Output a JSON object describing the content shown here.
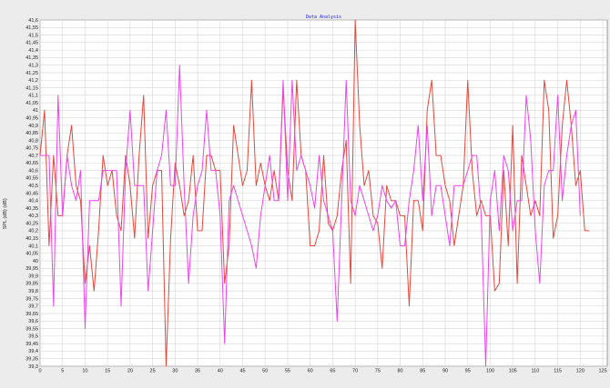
{
  "chart_data": {
    "type": "line",
    "title": "Data Analysis",
    "ylabel": "SPL (dB) (dB)",
    "xlabel": "",
    "grid": true,
    "legend": "none",
    "xlim": [
      0,
      126
    ],
    "ylim": [
      39.3,
      41.6
    ],
    "y_ticks": [
      "39,3",
      "39,35",
      "39,4",
      "39,45",
      "39,5",
      "39,55",
      "39,6",
      "39,65",
      "39,7",
      "39,75",
      "39,8",
      "39,85",
      "39,9",
      "39,95",
      "40",
      "40,05",
      "40,1",
      "40,15",
      "40,2",
      "40,25",
      "40,3",
      "40,35",
      "40,4",
      "40,45",
      "40,5",
      "40,55",
      "40,6",
      "40,65",
      "40,7",
      "40,75",
      "40,8",
      "40,85",
      "40,9",
      "40,95",
      "41",
      "41,05",
      "41,1",
      "41,15",
      "41,2",
      "41,25",
      "41,3",
      "41,35",
      "41,4",
      "41,45",
      "41,5",
      "41,55",
      "41,6"
    ],
    "y_tick_values": [
      39.3,
      39.35,
      39.4,
      39.45,
      39.5,
      39.55,
      39.6,
      39.65,
      39.7,
      39.75,
      39.8,
      39.85,
      39.9,
      39.95,
      40,
      40.05,
      40.1,
      40.15,
      40.2,
      40.25,
      40.3,
      40.35,
      40.4,
      40.45,
      40.5,
      40.55,
      40.6,
      40.65,
      40.7,
      40.75,
      40.8,
      40.85,
      40.9,
      40.95,
      41,
      41.05,
      41.1,
      41.15,
      41.2,
      41.25,
      41.3,
      41.35,
      41.4,
      41.45,
      41.5,
      41.55,
      41.6
    ],
    "x_ticks": [
      "0",
      "5",
      "10",
      "15",
      "20",
      "25",
      "30",
      "35",
      "40",
      "45",
      "50",
      "55",
      "60",
      "65",
      "70",
      "75",
      "80",
      "85",
      "90",
      "95",
      "100",
      "105",
      "110",
      "115",
      "120",
      "125"
    ],
    "x_tick_values": [
      0,
      5,
      10,
      15,
      20,
      25,
      30,
      35,
      40,
      45,
      50,
      55,
      60,
      65,
      70,
      75,
      80,
      85,
      90,
      95,
      100,
      105,
      110,
      115,
      120,
      125
    ],
    "series": [
      {
        "color": "#e8473b",
        "values": [
          40.7,
          41.0,
          40.1,
          40.7,
          40.3,
          40.3,
          40.7,
          40.9,
          40.5,
          40.4,
          39.85,
          40.1,
          39.8,
          40.2,
          40.7,
          40.5,
          40.6,
          40.3,
          40.2,
          40.7,
          40.5,
          40.15,
          40.7,
          41.1,
          40.15,
          40.5,
          40.6,
          40.6,
          39.3,
          40.15,
          40.65,
          40.5,
          40.3,
          40.4,
          40.7,
          40.2,
          40.2,
          40.7,
          40.7,
          40.6,
          40.6,
          39.85,
          40.1,
          40.9,
          40.7,
          40.5,
          40.6,
          41.2,
          40.5,
          40.65,
          40.5,
          40.4,
          40.6,
          40.4,
          41.15,
          40.6,
          40.4,
          41.2,
          40.7,
          40.6,
          40.1,
          40.1,
          40.2,
          40.7,
          40.25,
          40.2,
          40.3,
          40.6,
          40.8,
          39.85,
          41.6,
          40.9,
          40.5,
          40.6,
          40.3,
          40.25,
          39.95,
          40.5,
          40.4,
          40.4,
          40.3,
          40.3,
          39.7,
          40.4,
          40.4,
          40.2,
          41.0,
          41.2,
          40.7,
          40.7,
          40.5,
          40.4,
          40.1,
          40.3,
          40.5,
          41.2,
          40.6,
          40.3,
          40.4,
          40.3,
          40.3,
          39.8,
          39.85,
          40.6,
          40.1,
          40.9,
          39.85,
          40.7,
          40.5,
          40.3,
          40.4,
          40.3,
          41.2,
          41.0,
          40.15,
          40.3,
          40.9,
          41.2,
          40.9,
          40.5,
          40.6,
          40.2,
          40.2
        ],
        "x_start": 0
      },
      {
        "color": "#ee44ee",
        "values": [
          40.7,
          40.7,
          40.7,
          39.7,
          41.1,
          40.3,
          40.7,
          40.5,
          40.4,
          40.6,
          39.55,
          40.4,
          40.4,
          40.4,
          40.6,
          40.6,
          40.6,
          40.6,
          39.7,
          40.6,
          41.0,
          40.5,
          40.5,
          40.5,
          39.8,
          40.2,
          40.6,
          40.7,
          41.0,
          40.5,
          40.5,
          41.3,
          40.5,
          39.85,
          40.3,
          40.5,
          40.6,
          41.0,
          40.6,
          40.6,
          40.3,
          39.45,
          40.4,
          40.5,
          40.4,
          40.3,
          40.2,
          40.1,
          39.95,
          40.3,
          40.5,
          40.7,
          40.4,
          40.4,
          41.2,
          40.4,
          41.2,
          40.6,
          40.7,
          40.6,
          40.5,
          40.35,
          40.7,
          40.4,
          40.3,
          40.2,
          39.6,
          40.4,
          41.2,
          40.4,
          40.3,
          40.5,
          40.4,
          40.3,
          40.2,
          40.3,
          40.5,
          40.4,
          40.35,
          40.4,
          40.1,
          40.1,
          40.4,
          40.6,
          40.9,
          40.4,
          40.9,
          40.3,
          40.5,
          40.5,
          40.3,
          40.1,
          40.5,
          40.5,
          40.5,
          40.6,
          40.7,
          40.7,
          40.3,
          39.3,
          40.4,
          40.6,
          40.2,
          40.7,
          40.6,
          40.2,
          40.4,
          40.4,
          41.1,
          40.8,
          40.2,
          39.85,
          40.5,
          40.6,
          40.6,
          41.1,
          40.4,
          40.7,
          40.9,
          41.0,
          40.3
        ]
      }
    ]
  }
}
